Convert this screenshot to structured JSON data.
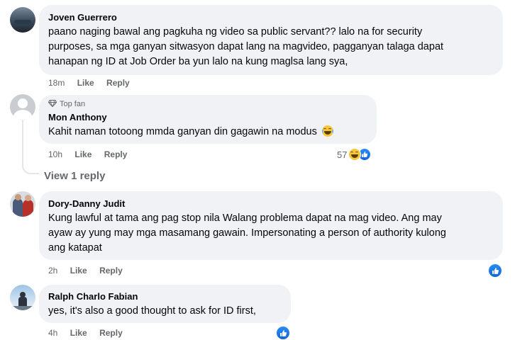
{
  "comments": [
    {
      "author": "Joven Guerrero",
      "lines": [
        "paano naging bawal ang pagkuha ng video sa public servant?? lalo na for security",
        "purposes, sa mga ganyan sitwasyon dapat lang na magvideo, pagganyan talaga dapat",
        "hanapan ng ID at Job Order ba yun lalo na kung maglsa lang sya,"
      ],
      "time": "18m",
      "like_label": "Like",
      "reply_label": "Reply"
    },
    {
      "badge": "Top fan",
      "author": "Mon Anthony",
      "text": "Kahit naman totoong mmda ganyan din gagawin na modus",
      "time": "10h",
      "like_label": "Like",
      "reply_label": "Reply",
      "reaction_count": "57",
      "reactions": [
        "haha-icon",
        "like-icon"
      ]
    },
    {
      "view_replies": "View 1 reply"
    },
    {
      "author": "Dory-Danny Judit",
      "lines": [
        "Kung lawful at tama ang pag stop nila Walang problema dapat na mag video. Ang may",
        "ayaw ay yung may mga masamang gawain. Impersonating a person of authority kulong",
        "ang katapat"
      ],
      "time": "2h",
      "like_label": "Like",
      "reply_label": "Reply",
      "reactions": [
        "like-icon"
      ]
    },
    {
      "author": "Ralph Charlo Fabian",
      "text": "yes, it's also a good thought to ask for ID first,",
      "time": "4h",
      "like_label": "Like",
      "reply_label": "Reply",
      "reactions": [
        "like-icon"
      ]
    }
  ],
  "colors": {
    "bubble": "#f0f2f5",
    "meta": "#65676b",
    "like_blue": "#1877f2",
    "haha_yellow": "#f7c73a"
  }
}
